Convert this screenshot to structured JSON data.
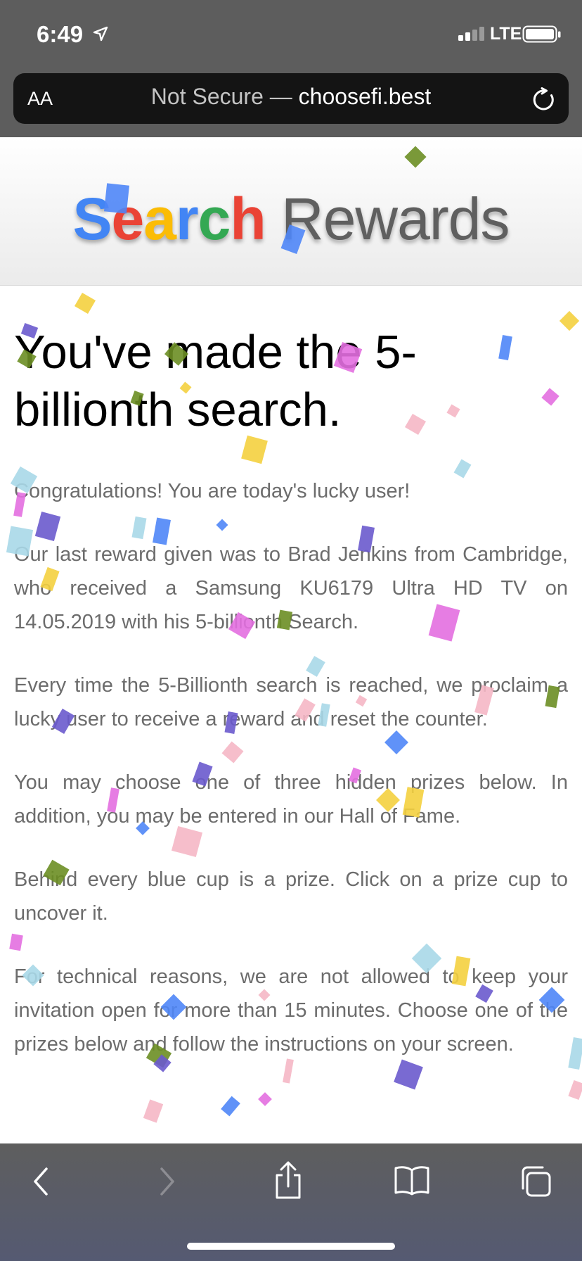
{
  "status_bar": {
    "time": "6:49",
    "network": "LTE"
  },
  "browser": {
    "text_size_label": "AA",
    "security_label": "Not Secure —",
    "domain": "choosefi.best"
  },
  "logo": {
    "letters": [
      {
        "char": "S",
        "color": "#4285f4"
      },
      {
        "char": "e",
        "color": "#ea4335"
      },
      {
        "char": "a",
        "color": "#fbbc05"
      },
      {
        "char": "r",
        "color": "#4285f4"
      },
      {
        "char": "c",
        "color": "#34a853"
      },
      {
        "char": "h",
        "color": "#ea4335"
      }
    ],
    "second_word": "Rewards"
  },
  "content": {
    "headline": "You've made the 5-billionth search.",
    "paragraphs": [
      "Congratulations! You are today's lucky user!",
      "Our last reward given was to Brad Jenkins from Cambridge, who received a Samsung KU6179 Ultra HD TV on 14.05.2019 with his 5-billionth Search.",
      "Every time the 5-Billionth search is reached, we proclaim a lucky user to receive a reward and reset the counter.",
      "You may choose one of three hidden prizes below. In addition, you may be entered in our Hall of Fame.",
      "Behind every blue cup is a prize. Click on a prize cup to uncover it.",
      "For technical reasons, we are not allowed to keep your invitation open for more than 15 minutes. Choose one of the prizes below and follow the instructions on your screen."
    ]
  },
  "toolbar": {
    "icons": [
      "back-icon",
      "forward-icon",
      "share-icon",
      "bookmarks-icon",
      "tabs-icon"
    ]
  },
  "colors": {
    "chrome_bg": "#5d5d5d",
    "url_field_bg": "#141414",
    "body_text": "#6c6c6c",
    "confetti": [
      "#f4d03f",
      "#4f86f7",
      "#6a5acd",
      "#e36fe0",
      "#f5b7c5",
      "#a8d8e8",
      "#90ee90",
      "#6b8e23"
    ]
  }
}
